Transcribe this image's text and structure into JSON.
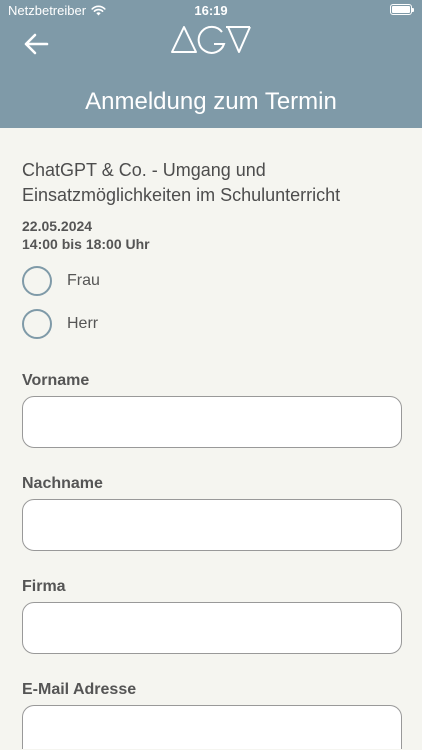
{
  "status_bar": {
    "carrier": "Netzbetreiber",
    "time": "16:19",
    "icons": [
      "wifi-icon",
      "battery-icon"
    ]
  },
  "header": {
    "back_icon": "arrow-left-icon",
    "logo": "AGV",
    "title": "Anmeldung zum Termin",
    "background_color": "#7f9aa8"
  },
  "event": {
    "title": "ChatGPT & Co. - Umgang und Einsatzmöglichkeiten im Schulunterricht",
    "date": "22.05.2024",
    "time": "14:00 bis 18:00 Uhr"
  },
  "salutation": {
    "options": [
      {
        "label": "Frau",
        "selected": false
      },
      {
        "label": "Herr",
        "selected": false
      }
    ]
  },
  "form": {
    "fields": [
      {
        "label": "Vorname",
        "value": "",
        "placeholder": ""
      },
      {
        "label": "Nachname",
        "value": "",
        "placeholder": ""
      },
      {
        "label": "Firma",
        "value": "",
        "placeholder": ""
      },
      {
        "label": "E-Mail Adresse",
        "value": "",
        "placeholder": ""
      }
    ]
  },
  "colors": {
    "accent": "#7f9aa8",
    "background": "#f5f5f0",
    "text": "#555555"
  }
}
